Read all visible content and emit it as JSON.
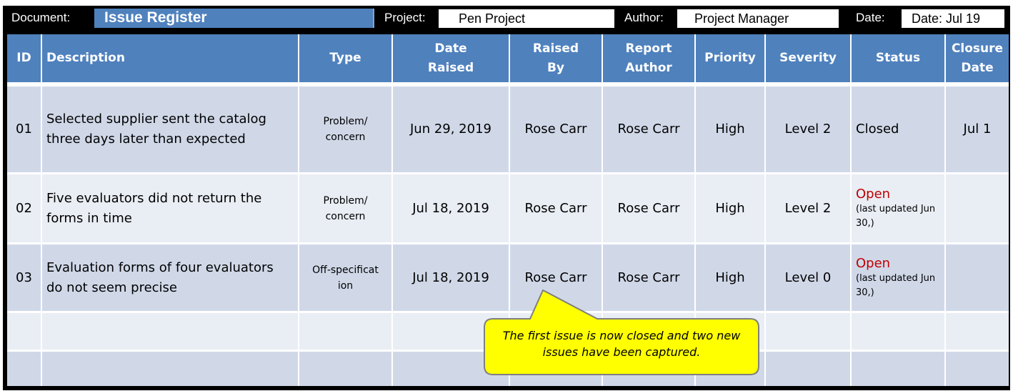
{
  "meta": {
    "document_label": "Document:",
    "document_value": "Issue Register",
    "project_label": "Project:",
    "project_value": "Pen Project",
    "author_label": "Author:",
    "author_value": "Project Manager",
    "date_label": "Date:",
    "date_value": "Date: Jul 19"
  },
  "table": {
    "headers": {
      "id": "ID",
      "description": "Description",
      "type": "Type",
      "date_raised": "Date Raised",
      "raised_by": "Raised By",
      "report_author": "Report Author",
      "priority": "Priority",
      "severity": "Severity",
      "status": "Status",
      "closure_date": "Closure Date"
    },
    "rows": [
      {
        "id": "01",
        "description": "Selected supplier sent the catalog three days later than expected",
        "type": "Problem/ concern",
        "date_raised": "Jun 29, 2019",
        "raised_by": "Rose Carr",
        "report_author": "Rose Carr",
        "priority": "High",
        "severity": "Level 2",
        "status": "Closed",
        "status_note": "",
        "closure_date": "Jul 1"
      },
      {
        "id": "02",
        "description": "Five evaluators did not return the forms in time",
        "type": "Problem/ concern",
        "date_raised": "Jul 18, 2019",
        "raised_by": "Rose Carr",
        "report_author": "Rose Carr",
        "priority": "High",
        "severity": "Level 2",
        "status": "Open",
        "status_note": "(last updated Jun 30,)",
        "closure_date": ""
      },
      {
        "id": "03",
        "description": "Evaluation forms of four evaluators do not seem precise",
        "type": "Off-specification",
        "date_raised": "Jul 18, 2019",
        "raised_by": "Rose Carr",
        "report_author": "Rose Carr",
        "priority": "High",
        "severity": "Level 0",
        "status": "Open",
        "status_note": "(last updated Jun 30,)",
        "closure_date": ""
      }
    ],
    "empty_rows": 2
  },
  "callout": {
    "text": "The first issue is now closed and two new issues have been captured."
  },
  "colors": {
    "header_blue": "#4f81bd",
    "row_dark": "#d0d8e8",
    "row_light": "#e9edf4",
    "open_red": "#c00000",
    "callout_yellow": "#ffff00"
  }
}
